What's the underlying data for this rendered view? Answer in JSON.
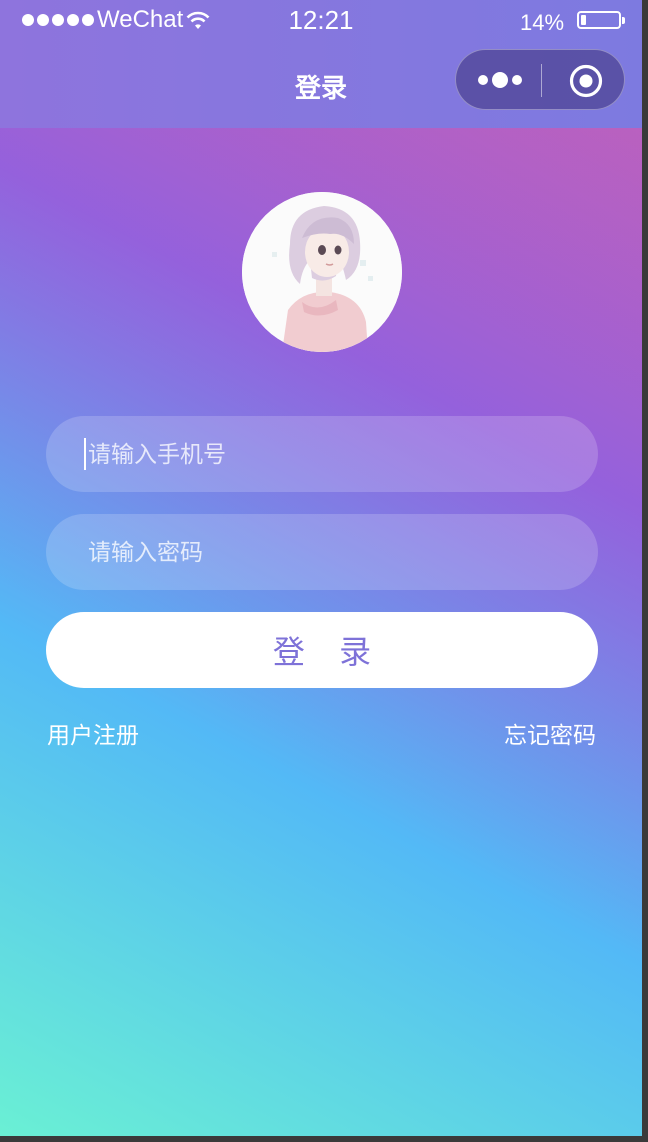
{
  "status_bar": {
    "carrier": "WeChat",
    "time": "12:21",
    "battery_percent": "14%",
    "battery_level": 0.14
  },
  "nav": {
    "title": "登录",
    "more_icon": "more-dots-icon",
    "close_icon": "target-circle-icon"
  },
  "login": {
    "phone_placeholder": "请输入手机号",
    "password_placeholder": "请输入密码",
    "submit_label": "登 录",
    "register_link": "用户注册",
    "forgot_link": "忘记密码"
  },
  "colors": {
    "header": "#8a76de",
    "button_text": "#7e72d8",
    "gradient_pink": "#dc5fb0",
    "gradient_purple": "#9b60dc",
    "gradient_blue": "#53b9f6",
    "gradient_teal": "#6af0d4"
  }
}
